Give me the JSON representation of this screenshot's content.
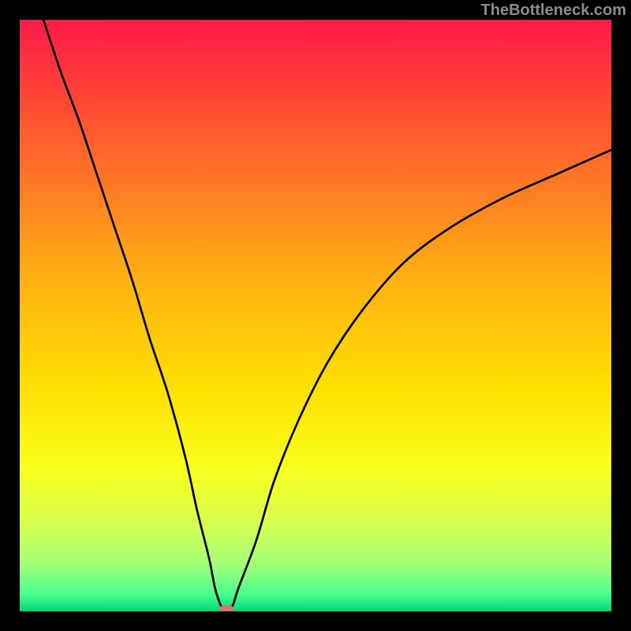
{
  "watermark": "TheBottleneck.com",
  "chart_data": {
    "type": "line",
    "title": "",
    "xlabel": "",
    "ylabel": "",
    "xlim": [
      0,
      100
    ],
    "ylim": [
      0,
      100
    ],
    "grid": false,
    "legend": false,
    "background": "rainbow-vertical",
    "series": [
      {
        "name": "bottleneck-curve",
        "x": [
          4,
          7,
          10,
          13,
          16,
          19,
          22,
          25,
          28,
          30,
          32,
          33,
          34,
          35,
          36,
          37,
          40,
          43,
          47,
          52,
          58,
          65,
          73,
          82,
          91,
          100
        ],
        "y": [
          100,
          91,
          83,
          74,
          65,
          56,
          46,
          37,
          26,
          17,
          9,
          4,
          1,
          0,
          1,
          4,
          12,
          22,
          32,
          42,
          51,
          59,
          65,
          70,
          74,
          78
        ]
      }
    ],
    "marker": {
      "name": "optimum-point",
      "x": 35,
      "y": 0,
      "shape": "rounded-rect",
      "color": "#d9786d"
    }
  },
  "colors": {
    "frame": "#000000",
    "curve": "#000000",
    "marker": "#d9786d",
    "watermark": "#8b8b8b"
  }
}
